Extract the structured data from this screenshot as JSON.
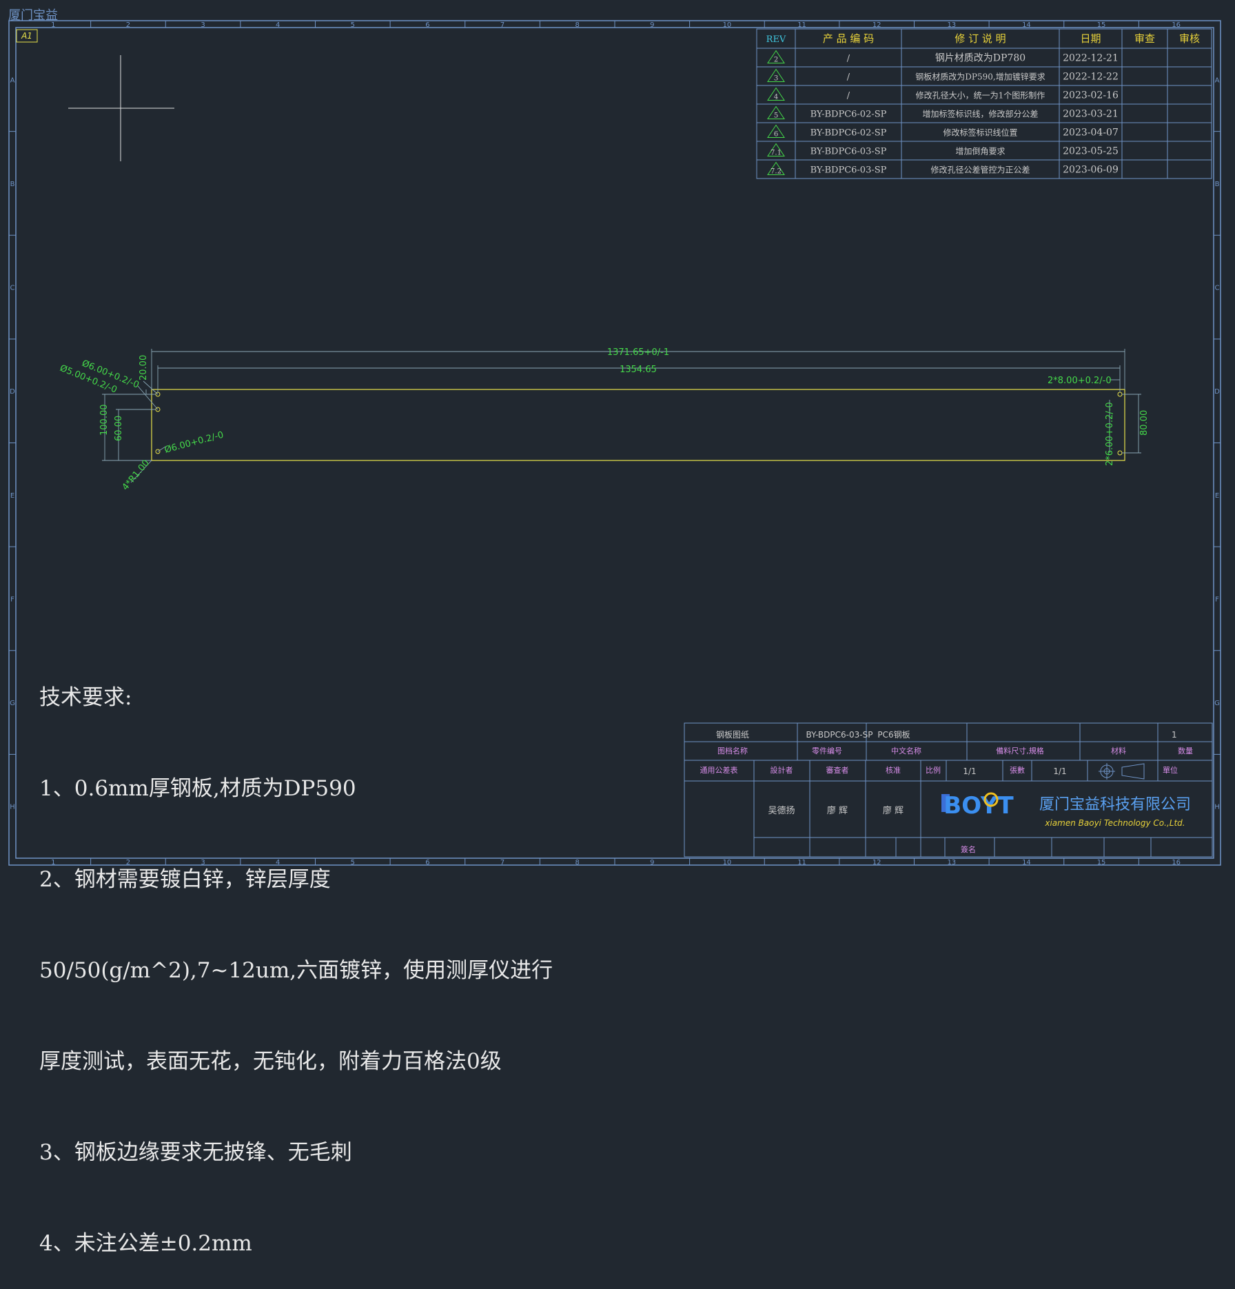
{
  "app": {
    "title": "厦门宝益"
  },
  "sheet": {
    "label": "A1",
    "columns": [
      "1",
      "2",
      "3",
      "4",
      "5",
      "6",
      "7",
      "8",
      "9",
      "10",
      "11",
      "12",
      "13",
      "14",
      "15",
      "16"
    ],
    "rows": [
      "A",
      "B",
      "C",
      "D",
      "E",
      "F",
      "G",
      "H"
    ]
  },
  "revision_table": {
    "headers": [
      "REV",
      "产 品 编 码",
      "修 订 说 明",
      "日期",
      "审查",
      "审核"
    ],
    "rows": [
      {
        "rev": "2",
        "code": "/",
        "desc": "钢片材质改为DP780",
        "date": "2022-12-21"
      },
      {
        "rev": "3",
        "code": "/",
        "desc": "钢板材质改为DP590,增加镀锌要求",
        "date": "2022-12-22"
      },
      {
        "rev": "4",
        "code": "/",
        "desc": "修改孔径大小，统一为1个图形制作",
        "date": "2023-02-16"
      },
      {
        "rev": "5",
        "code": "BY-BDPC6-02-SP",
        "desc": "增加标签标识线，修改部分公差",
        "date": "2023-03-21"
      },
      {
        "rev": "6",
        "code": "BY-BDPC6-02-SP",
        "desc": "修改标签标识线位置",
        "date": "2023-04-07"
      },
      {
        "rev": "7.1",
        "code": "BY-BDPC6-03-SP",
        "desc": "增加倒角要求",
        "date": "2023-05-25"
      },
      {
        "rev": "7.2",
        "code": "BY-BDPC6-03-SP",
        "desc": "修改孔径公差管控为正公差",
        "date": "2023-06-09"
      }
    ]
  },
  "dimensions": {
    "overall": "1371.65+0/-1",
    "inner": "1354.65",
    "hole_top_1": "Ø6.00+0.2/-0",
    "hole_top_2": "Ø5.00+0.2/-0",
    "hole_bottom": "Ø6.00+0.2/-0",
    "v_20": "20.00",
    "v_100": "100.00",
    "v_60": "60.00",
    "corner": "4*R1.00",
    "right_holes_top": "2*8.00+0.2/-0",
    "right_holes_side": "2*6.00+0.2/-0",
    "right_80": "80.00"
  },
  "tech_requirements": {
    "title": "技术要求:",
    "lines": [
      "1、0.6mm厚钢板,材质为DP590",
      "2、钢材需要镀白锌，锌层厚度",
      "50/50(g/m^2),7~12um,六面镀锌，使用测厚仪进行",
      "厚度测试，表面无花，无钝化，附着力百格法0级",
      "3、钢板边缘要求无披锋、无毛刺",
      "4、未注公差±0.2mm"
    ]
  },
  "title_block": {
    "drawing_type": "钢板图纸",
    "part_number": "BY-BDPC6-03-SP",
    "name": "PC6钢板",
    "quantity": "1",
    "labels": {
      "drawing_name": "图档名称",
      "part_no": "零件编号",
      "cn_name": "中文名称",
      "blank_size": "備料尺寸,規格",
      "material": "材料",
      "qty": "数量",
      "tolerance": "通用公差表",
      "designer": "設計者",
      "reviewer": "審查者",
      "approver": "核准",
      "scale": "比例",
      "sheets": "張數",
      "unit": "單位",
      "signature": "簽名"
    },
    "scale_value": "1/1",
    "sheets_value": "1/1",
    "designer_name": "吴德扬",
    "reviewer_name": "廖 辉",
    "approver_name": "廖 辉",
    "company_logo": "BOYT",
    "company_name_cn": "厦门宝益科技有限公司",
    "company_name_en": "xiamen Baoyi Technology Co.,Ltd."
  }
}
